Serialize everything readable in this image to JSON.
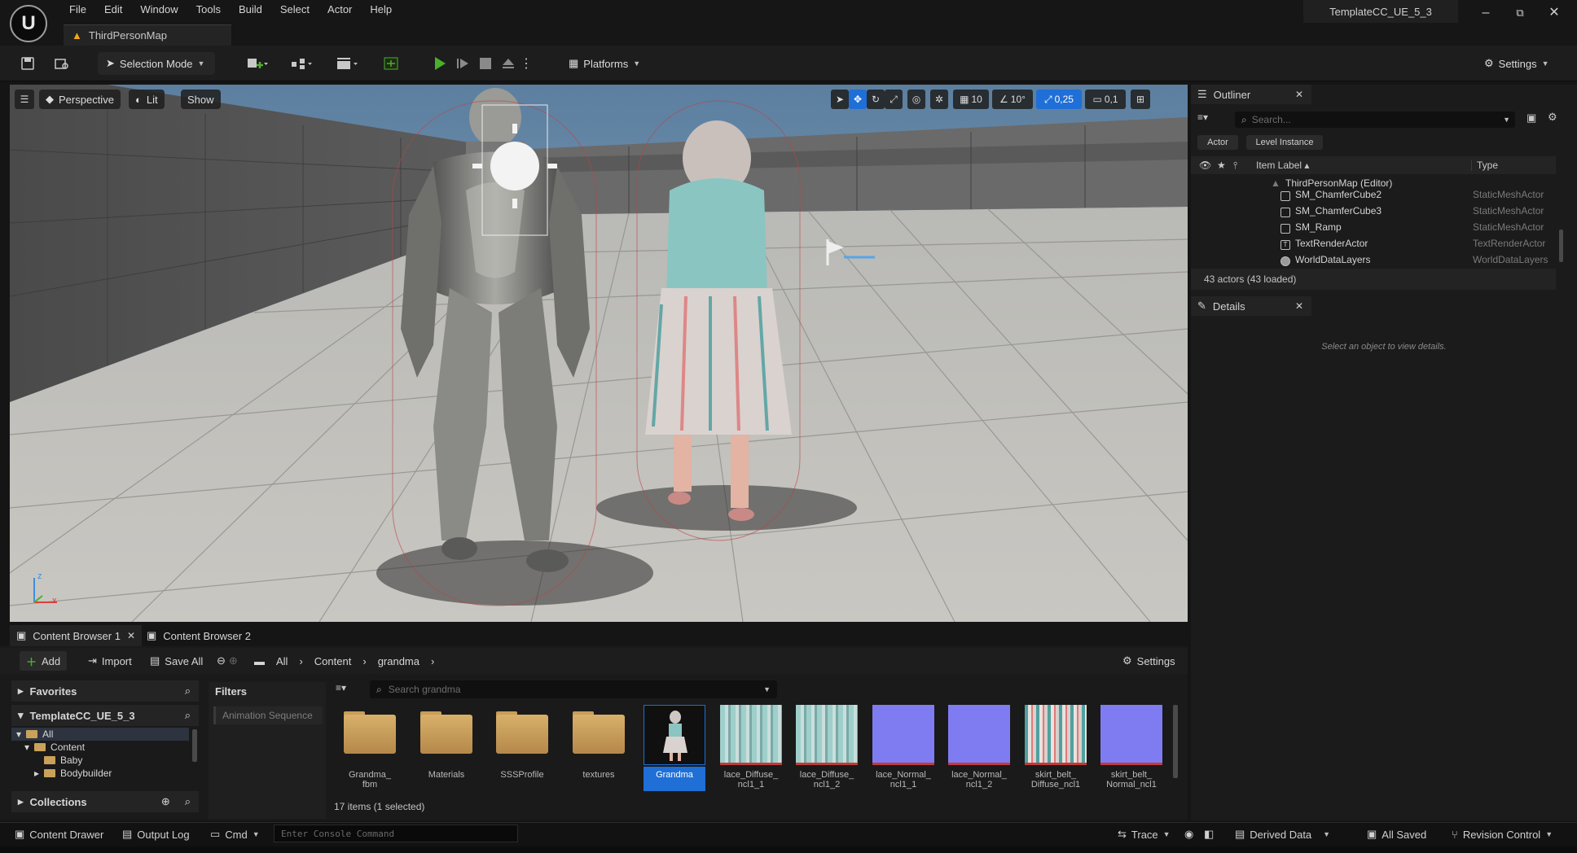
{
  "app": {
    "project_name": "TemplateCC_UE_5_3",
    "menu": [
      "File",
      "Edit",
      "Window",
      "Tools",
      "Build",
      "Select",
      "Actor",
      "Help"
    ],
    "map_tab": "ThirdPersonMap",
    "window_controls": [
      "–",
      "⧉",
      "✕"
    ]
  },
  "toolbar": {
    "selection_mode": "Selection Mode",
    "platforms": "Platforms",
    "settings": "Settings"
  },
  "viewport": {
    "perspective": "Perspective",
    "lit": "Lit",
    "show": "Show",
    "grid_snap": "10",
    "rotation_snap": "10°",
    "scale_snap": "0,25",
    "camera_speed": "0,1",
    "axis_x": "x",
    "axis_z": "z"
  },
  "outliner": {
    "title": "Outliner",
    "search_placeholder": "Search...",
    "filters": [
      "Actor",
      "Level Instance"
    ],
    "col_label": "Item Label ▴",
    "col_type": "Type",
    "root": "ThirdPersonMap (Editor)",
    "rows": [
      {
        "label": "SM_ChamferCube2",
        "type": "StaticMeshActor"
      },
      {
        "label": "SM_ChamferCube3",
        "type": "StaticMeshActor"
      },
      {
        "label": "SM_Ramp",
        "type": "StaticMeshActor"
      },
      {
        "label": "TextRenderActor",
        "type": "TextRenderActor"
      },
      {
        "label": "WorldDataLayers",
        "type": "WorldDataLayers"
      }
    ],
    "footer": "43 actors (43 loaded)"
  },
  "details": {
    "title": "Details",
    "empty_message": "Select an object to view details."
  },
  "content_browser": {
    "tabs": [
      "Content Browser 1",
      "Content Browser 2"
    ],
    "add": "Add",
    "import": "Import",
    "save_all": "Save All",
    "breadcrumb": [
      "All",
      "Content",
      "grandma"
    ],
    "settings": "Settings",
    "favorites": "Favorites",
    "project": "TemplateCC_UE_5_3",
    "tree": [
      "All",
      "Content",
      "Baby",
      "Bodybuilder"
    ],
    "collections": "Collections",
    "filters_title": "Filters",
    "filter_chip": "Animation Sequence",
    "search_placeholder": "Search grandma",
    "status": "17 items (1 selected)",
    "assets": [
      {
        "name": "Grandma_\nfbm",
        "kind": "folder"
      },
      {
        "name": "Materials",
        "kind": "folder"
      },
      {
        "name": "SSSProfile",
        "kind": "folder"
      },
      {
        "name": "textures",
        "kind": "folder"
      },
      {
        "name": "Grandma",
        "kind": "skeletal",
        "selected": true
      },
      {
        "name": "lace_Diffuse_\nncl1_1",
        "kind": "diffuse"
      },
      {
        "name": "lace_Diffuse_\nncl1_2",
        "kind": "diffuse"
      },
      {
        "name": "lace_Normal_\nncl1_1",
        "kind": "normal"
      },
      {
        "name": "lace_Normal_\nncl1_2",
        "kind": "normal"
      },
      {
        "name": "skirt_belt_\nDiffuse_ncl1",
        "kind": "skirt"
      },
      {
        "name": "skirt_belt_\nNormal_ncl1",
        "kind": "normal"
      }
    ]
  },
  "statusbar": {
    "content_drawer": "Content Drawer",
    "output_log": "Output Log",
    "cmd": "Cmd",
    "console_placeholder": "Enter Console Command",
    "trace": "Trace",
    "derived_data": "Derived Data",
    "all_saved": "All Saved",
    "revision_control": "Revision Control"
  },
  "colors": {
    "accent": "#1f6fd6",
    "play": "#4caf2a",
    "panel": "#1b1b1b"
  }
}
